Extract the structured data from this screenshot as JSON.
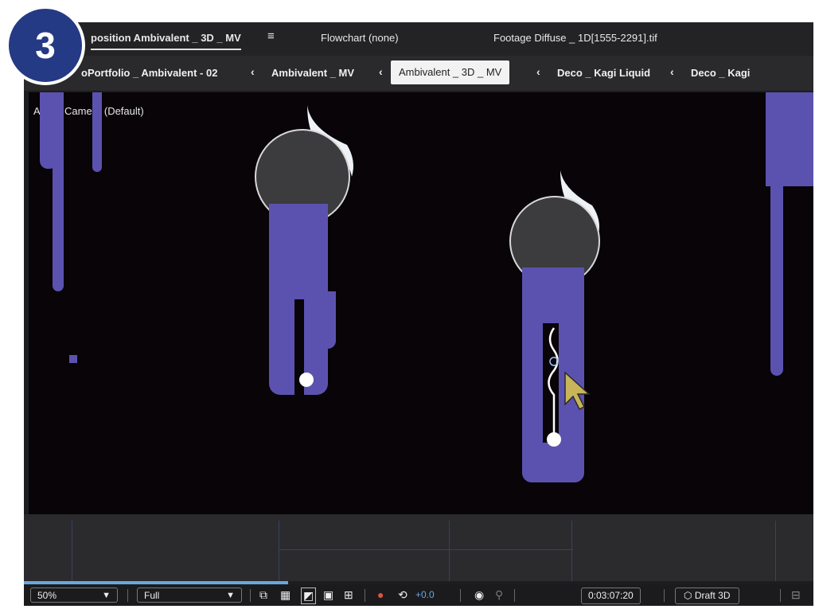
{
  "step_badge": "3",
  "tabs": {
    "composition": "position Ambivalent _ 3D _ MV",
    "menu_glyph": "≡",
    "flowchart": "Flowchart (none)",
    "footage": "Footage Diffuse _ 1D[1555-2291].tif"
  },
  "breadcrumbs": [
    {
      "label": "oPortfolio _ Ambivalent - 02"
    },
    {
      "label": "Ambivalent _ MV"
    },
    {
      "label": "Ambivalent _ 3D _ MV"
    },
    {
      "label": "Deco _ Kagi Liquid"
    },
    {
      "label": "Deco _ Kagi"
    }
  ],
  "viewer": {
    "camera_label": "Active Camera (Default)"
  },
  "statusbar": {
    "zoom": "50%",
    "resolution": "Full",
    "exposure": "+0.0",
    "timecode": "0:03:07:20",
    "renderer": "Draft 3D"
  },
  "colors": {
    "accent": "#5b52b0",
    "progress": "#6aa7e0",
    "badge": "#243a84"
  }
}
